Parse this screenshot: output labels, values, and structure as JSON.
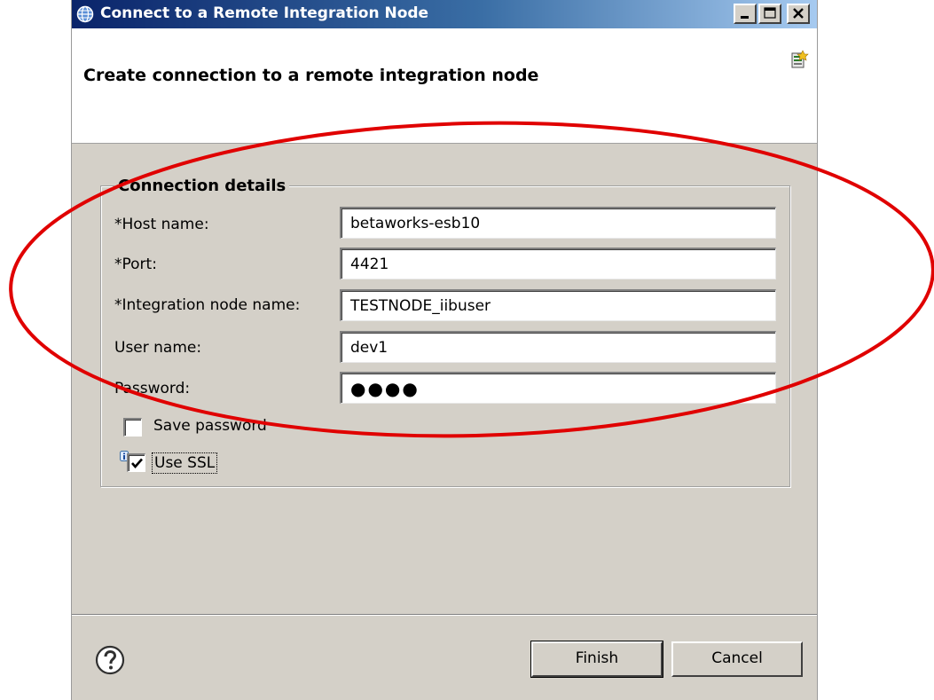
{
  "window": {
    "title": "Connect to a Remote Integration Node",
    "icon": "globe-icon"
  },
  "banner": {
    "title": "Create connection to a remote integration node",
    "icon": "connection-wizard-icon"
  },
  "group": {
    "legend": "Connection details"
  },
  "fields": [
    {
      "label": "*Host name:",
      "value": "betaworks-esb10"
    },
    {
      "label": "*Port:",
      "value": "4421"
    },
    {
      "label": "*Integration node name:",
      "value": "TESTNODE_iibuser"
    },
    {
      "label": "User name:",
      "value": "dev1"
    },
    {
      "label": "Password:",
      "value": "●●●●"
    }
  ],
  "save_password": {
    "label": "Save password",
    "checked": false
  },
  "use_ssl": {
    "label": "Use SSL",
    "checked": true
  },
  "buttons": {
    "finish": "Finish",
    "cancel": "Cancel"
  },
  "colors": {
    "dialog_bg": "#d4d0c8",
    "titlebar": "#0a246a",
    "annotation": "#e00000"
  }
}
